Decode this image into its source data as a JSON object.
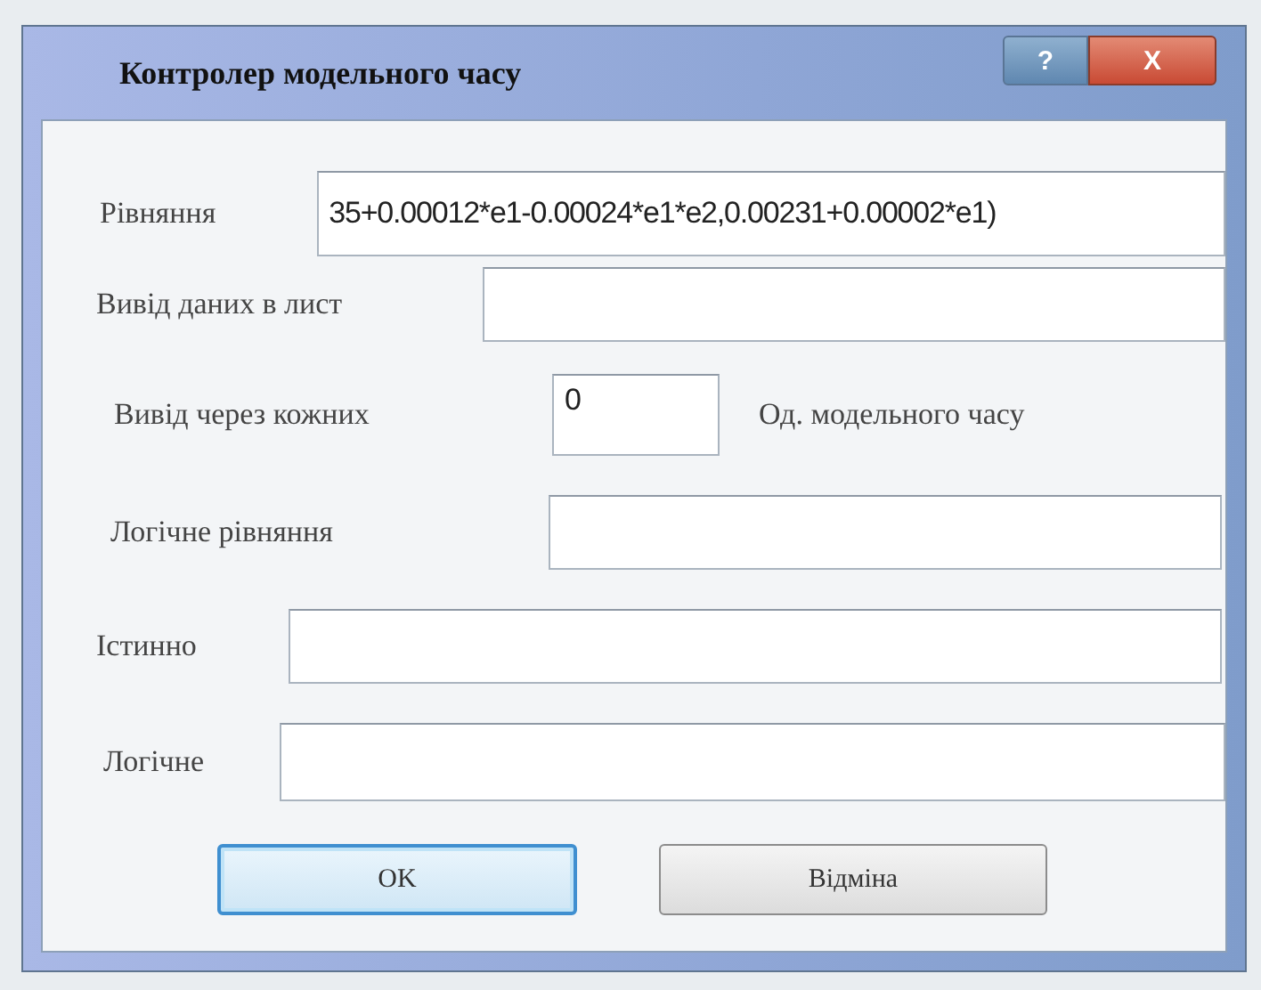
{
  "window": {
    "title": "Контролер модельного часу",
    "help_button": "?",
    "close_button": "X"
  },
  "rows": [
    {
      "label": "Рівняння",
      "value": "35+0.00012*e1-0.00024*e1*e2,0.00231+0.00002*e1)"
    },
    {
      "label": "Вивід даних в лист"
    },
    {
      "label": "Вивід через кожних",
      "value": "0",
      "suffix": "Од. модельного часу"
    },
    {
      "label": "Логічне рівняння"
    },
    {
      "label": "Істинно"
    },
    {
      "label": "Логічне"
    }
  ],
  "buttons": [
    {
      "label": "OK",
      "default": true
    },
    {
      "label": "Відміна",
      "default": false
    }
  ]
}
